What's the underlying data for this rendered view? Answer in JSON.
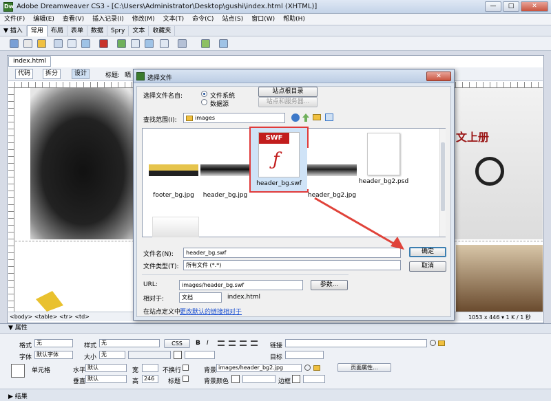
{
  "window": {
    "title": "Adobe Dreamweaver CS3 - [C:\\Users\\Administrator\\Desktop\\gushi\\index.html (XHTML)]",
    "min": "—",
    "max": "□",
    "close": "✕"
  },
  "menu": [
    "文件(F)",
    "编辑(E)",
    "查看(V)",
    "插入记录(I)",
    "修改(M)",
    "文本(T)",
    "命令(C)",
    "站点(S)",
    "窗口(W)",
    "帮助(H)"
  ],
  "insert_tabs": [
    "▼ 插入",
    "常用",
    "布局",
    "表单",
    "数据",
    "Spry",
    "文本",
    "收藏夹"
  ],
  "doc": {
    "tab": "index.html",
    "views": [
      "代码",
      "拆分",
      "设计"
    ],
    "title_label": "标题:",
    "title_value": "晒"
  },
  "status": {
    "tags": "<body> <table> <tr> <td>",
    "info": "1053 x 446 ▾ 1 K / 1 秒"
  },
  "canvas": {
    "right_text": "文上册"
  },
  "properties": {
    "header": "▼ 属性",
    "format_label": "格式",
    "format_value": "无",
    "style_label": "样式",
    "style_value": "无",
    "css_btn": "CSS",
    "bold": "B",
    "italic": "I",
    "link_label": "链接",
    "font_label": "字体",
    "font_value": "默认字体",
    "size_label": "大小",
    "size_value": "无",
    "target_label": "目标",
    "cell_label": "单元格",
    "horz_label": "水平",
    "horz_value": "默认",
    "vert_label": "垂直",
    "vert_value": "默认",
    "width_label": "宽",
    "height_label": "高",
    "height_value": "246",
    "nowrap_label": "不换行",
    "header_label": "标题",
    "bg_label": "背景",
    "bg_value": "images/header_bg2.jpg",
    "bgcolor_label": "背景颜色",
    "border_label": "边框",
    "page_props": "页面属性...",
    "results": "▶ 结果"
  },
  "dialog": {
    "title": "选择文件",
    "close": "✕",
    "select_from": "选择文件名自:",
    "opt_fs": "文件系统",
    "opt_ds": "数据源",
    "site_root": "站点根目录",
    "site_server": "站点和服务器...",
    "look_in": "查找范围(I):",
    "folder": "images",
    "files": [
      {
        "name": "footer_bg.jpg"
      },
      {
        "name": "header_bg.jpg"
      },
      {
        "name": "header_bg.swf",
        "badge": "SWF"
      },
      {
        "name": "header_bg2.jpg"
      },
      {
        "name": "header_bg2.psd"
      }
    ],
    "filename_label": "文件名(N):",
    "filename_value": "header_bg.swf",
    "filetype_label": "文件类型(T):",
    "filetype_value": "所有文件 (*.*)",
    "ok": "确定",
    "cancel": "取消",
    "url_label": "URL:",
    "url_value": "images/header_bg.swf",
    "params": "参数...",
    "relative_label": "相对于:",
    "relative_value": "文档",
    "relative_file": "index.html",
    "site_def_prefix": "在站点定义中",
    "site_def_link": "更改默认的链接相对于",
    "highlight_color": "#e03a3a",
    "arrow_color": "#e0433a"
  }
}
